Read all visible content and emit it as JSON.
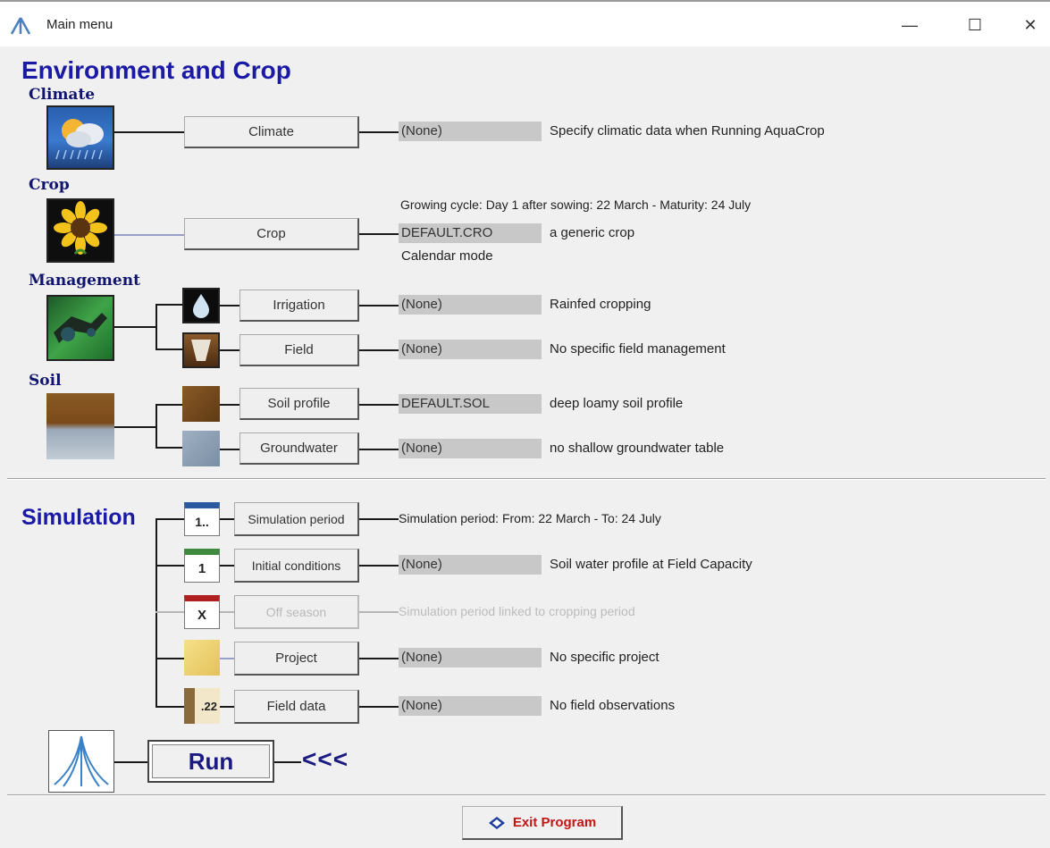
{
  "window": {
    "title": "Main menu",
    "minimize": "—",
    "maximize": "☐",
    "close": "✕"
  },
  "env": {
    "title": "Environment and Crop",
    "climate": {
      "section": "Climate",
      "button": "Climate",
      "file": "(None)",
      "desc": "Specify climatic data when Running AquaCrop"
    },
    "crop": {
      "section": "Crop",
      "growing_cycle": "Growing cycle:  Day 1 after sowing: 22 March  -  Maturity: 24 July",
      "button": "Crop",
      "file": "DEFAULT.CRO",
      "desc": "a generic crop",
      "mode": "Calendar mode"
    },
    "management": {
      "section": "Management",
      "irrigation": {
        "button": "Irrigation",
        "file": "(None)",
        "desc": "Rainfed cropping"
      },
      "field": {
        "button": "Field",
        "file": "(None)",
        "desc": "No specific field management"
      }
    },
    "soil": {
      "section": "Soil",
      "profile": {
        "button": "Soil profile",
        "file": "DEFAULT.SOL",
        "desc": "deep loamy soil profile"
      },
      "groundwater": {
        "button": "Groundwater",
        "file": "(None)",
        "desc": "no shallow groundwater table"
      }
    }
  },
  "sim": {
    "title": "Simulation",
    "period": {
      "icon_text": "1..",
      "button": "Simulation period",
      "desc": "Simulation period: From: 22 March  -  To: 24 July"
    },
    "initial": {
      "icon_text": "1",
      "button": "Initial conditions",
      "file": "(None)",
      "desc": "Soil water profile at Field Capacity"
    },
    "offseason": {
      "icon_text": "X",
      "button": "Off season",
      "desc": "Simulation period linked to cropping period"
    },
    "project": {
      "button": "Project",
      "file": "(None)",
      "desc": "No specific project"
    },
    "fielddata": {
      "icon_text": ".22",
      "button": "Field data",
      "file": "(None)",
      "desc": "No field observations"
    }
  },
  "run": {
    "label": "Run",
    "arrows": "<<<"
  },
  "exit": {
    "label": "Exit Program"
  },
  "colors": {
    "accent": "#1a1aa6",
    "file_bg": "#c8c8c8",
    "exit_text": "#c41414"
  }
}
